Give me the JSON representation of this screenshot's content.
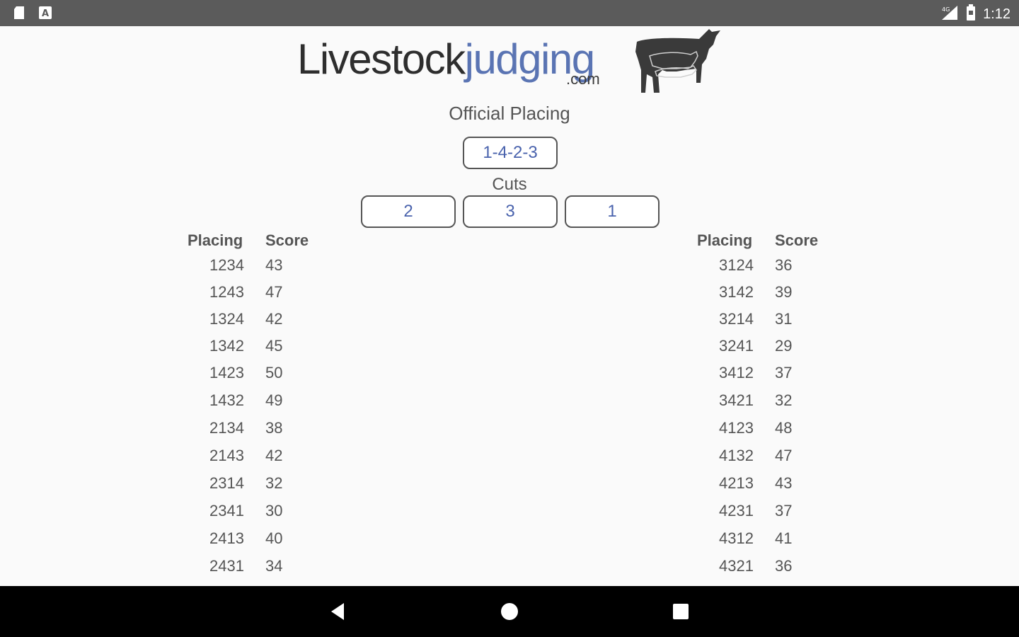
{
  "status_bar": {
    "time": "1:12",
    "left_icons": [
      "sd-card-icon",
      "a-notification-icon"
    ],
    "right_icons": [
      "signal-icon",
      "battery-icon"
    ]
  },
  "logo": {
    "part1": "Livestock",
    "part2": "judging",
    "suffix": ".com",
    "colors": {
      "dark": "#2e2e2e",
      "blue": "#5a74b3"
    }
  },
  "official": {
    "title": "Official Placing",
    "value": "1-4-2-3"
  },
  "cuts": {
    "title": "Cuts",
    "values": [
      "2",
      "3",
      "1"
    ]
  },
  "table": {
    "headers": {
      "placing": "Placing",
      "score": "Score"
    },
    "left": [
      {
        "placing": "1234",
        "score": "43"
      },
      {
        "placing": "1243",
        "score": "47"
      },
      {
        "placing": "1324",
        "score": "42"
      },
      {
        "placing": "1342",
        "score": "45"
      },
      {
        "placing": "1423",
        "score": "50"
      },
      {
        "placing": "1432",
        "score": "49"
      },
      {
        "placing": "2134",
        "score": "38"
      },
      {
        "placing": "2143",
        "score": "42"
      },
      {
        "placing": "2314",
        "score": "32"
      },
      {
        "placing": "2341",
        "score": "30"
      },
      {
        "placing": "2413",
        "score": "40"
      },
      {
        "placing": "2431",
        "score": "34"
      }
    ],
    "right": [
      {
        "placing": "3124",
        "score": "36"
      },
      {
        "placing": "3142",
        "score": "39"
      },
      {
        "placing": "3214",
        "score": "31"
      },
      {
        "placing": "3241",
        "score": "29"
      },
      {
        "placing": "3412",
        "score": "37"
      },
      {
        "placing": "3421",
        "score": "32"
      },
      {
        "placing": "4123",
        "score": "48"
      },
      {
        "placing": "4132",
        "score": "47"
      },
      {
        "placing": "4213",
        "score": "43"
      },
      {
        "placing": "4231",
        "score": "37"
      },
      {
        "placing": "4312",
        "score": "41"
      },
      {
        "placing": "4321",
        "score": "36"
      }
    ]
  },
  "nav_bar": {
    "icons": [
      "back-icon",
      "home-icon",
      "recents-icon"
    ]
  }
}
